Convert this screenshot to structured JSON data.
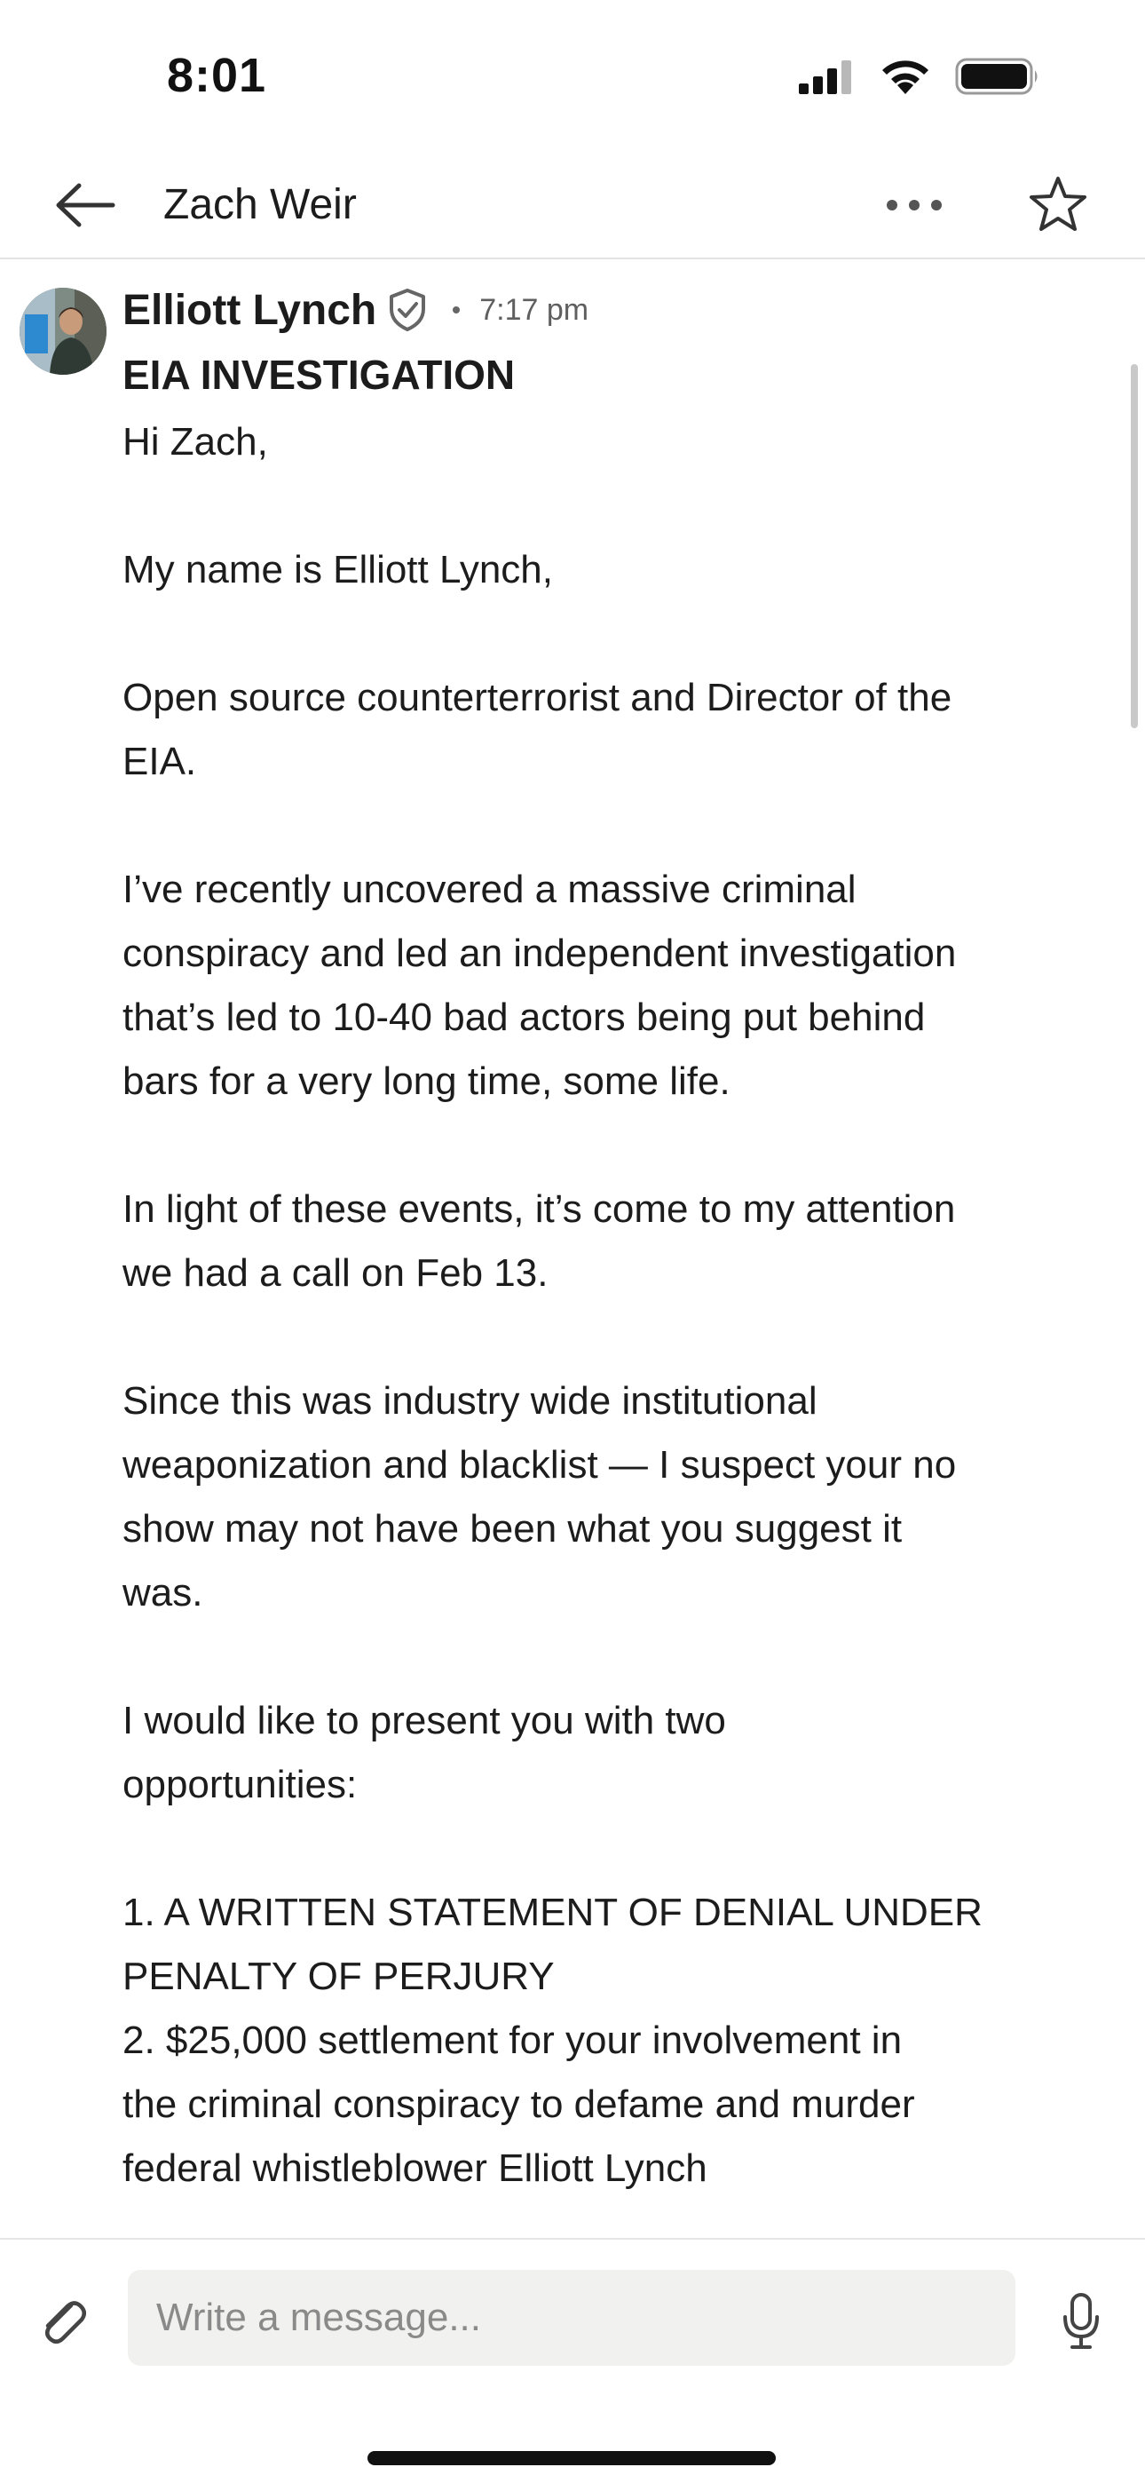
{
  "status": {
    "time": "8:01"
  },
  "header": {
    "title": "Zach Weir"
  },
  "message": {
    "sender": "Elliott Lynch",
    "time": "7:17 pm",
    "subject": "EIA INVESTIGATION",
    "lines": [
      "Hi Zach,",
      "",
      "My name is Elliott Lynch,",
      "",
      "Open source counterterrorist and Director of the",
      "EIA.",
      "",
      "I’ve recently uncovered a massive criminal",
      "conspiracy and led an independent investigation",
      "that’s led to 10-40 bad actors being put behind",
      "bars for a very long time, some life.",
      "",
      "In light of these events, it’s come to my attention",
      "we had a call on Feb 13.",
      "",
      "Since this was industry wide institutional",
      "weaponization and blacklist — I suspect your no",
      "show may not have been what you suggest it",
      "was.",
      "",
      "I would like to present you with two",
      "opportunities:",
      "",
      "1. A WRITTEN STATEMENT OF DENIAL UNDER",
      "PENALTY OF PERJURY",
      "2. $25,000 settlement for your involvement in",
      "the criminal conspiracy to defame and murder",
      "federal whistleblower Elliott Lynch"
    ]
  },
  "composer": {
    "placeholder": "Write a message..."
  },
  "icons": {
    "back": "arrow-left-icon",
    "more": "more-horizontal-icon",
    "star": "star-outline-icon",
    "verified": "shield-check-icon",
    "attach": "paperclip-icon",
    "mic": "microphone-icon"
  }
}
